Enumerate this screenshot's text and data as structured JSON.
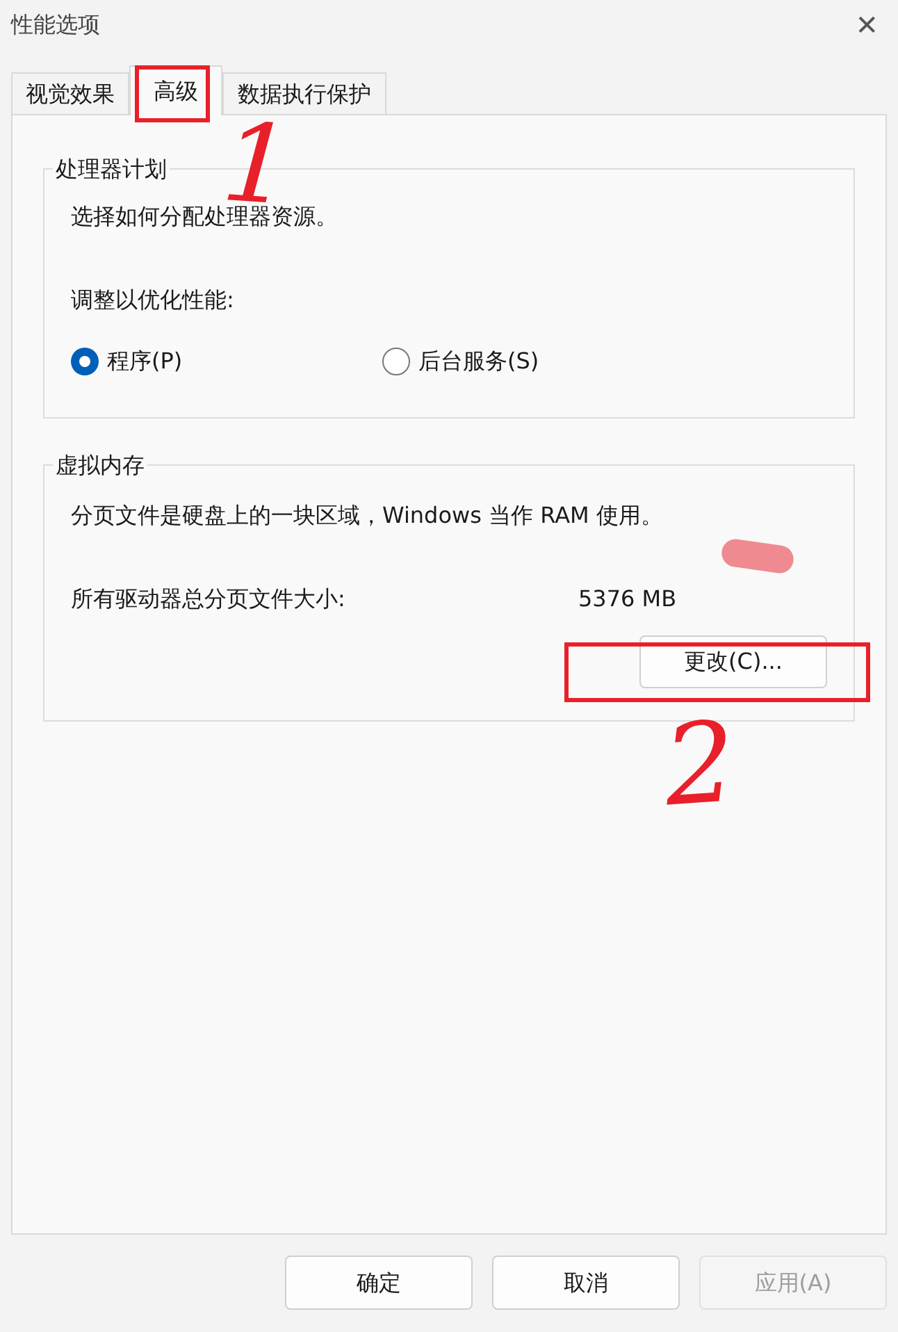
{
  "window": {
    "title": "性能选项",
    "close": "✕"
  },
  "tabs": [
    {
      "label": "视觉效果",
      "selected": false
    },
    {
      "label": "高级",
      "selected": true
    },
    {
      "label": "数据执行保护",
      "selected": false
    }
  ],
  "processor_group": {
    "title": "处理器计划",
    "description": "选择如何分配处理器资源。",
    "prompt": "调整以优化性能:",
    "options": [
      {
        "label": "程序(P)",
        "selected": true
      },
      {
        "label": "后台服务(S)",
        "selected": false
      }
    ]
  },
  "memory_group": {
    "title": "虚拟内存",
    "description": "分页文件是硬盘上的一块区域，Windows 当作 RAM 使用。",
    "size_label": "所有驱动器总分页文件大小:",
    "size_value": "5376 MB",
    "change_button": "更改(C)..."
  },
  "buttons": [
    {
      "label": "确定",
      "disabled": false
    },
    {
      "label": "取消",
      "disabled": false
    },
    {
      "label": "应用(A)",
      "disabled": true
    }
  ],
  "annotations": [
    {
      "kind": "box"
    },
    {
      "kind": "number",
      "text": "1"
    },
    {
      "kind": "blob"
    },
    {
      "kind": "box"
    },
    {
      "kind": "number",
      "text": "2"
    }
  ]
}
